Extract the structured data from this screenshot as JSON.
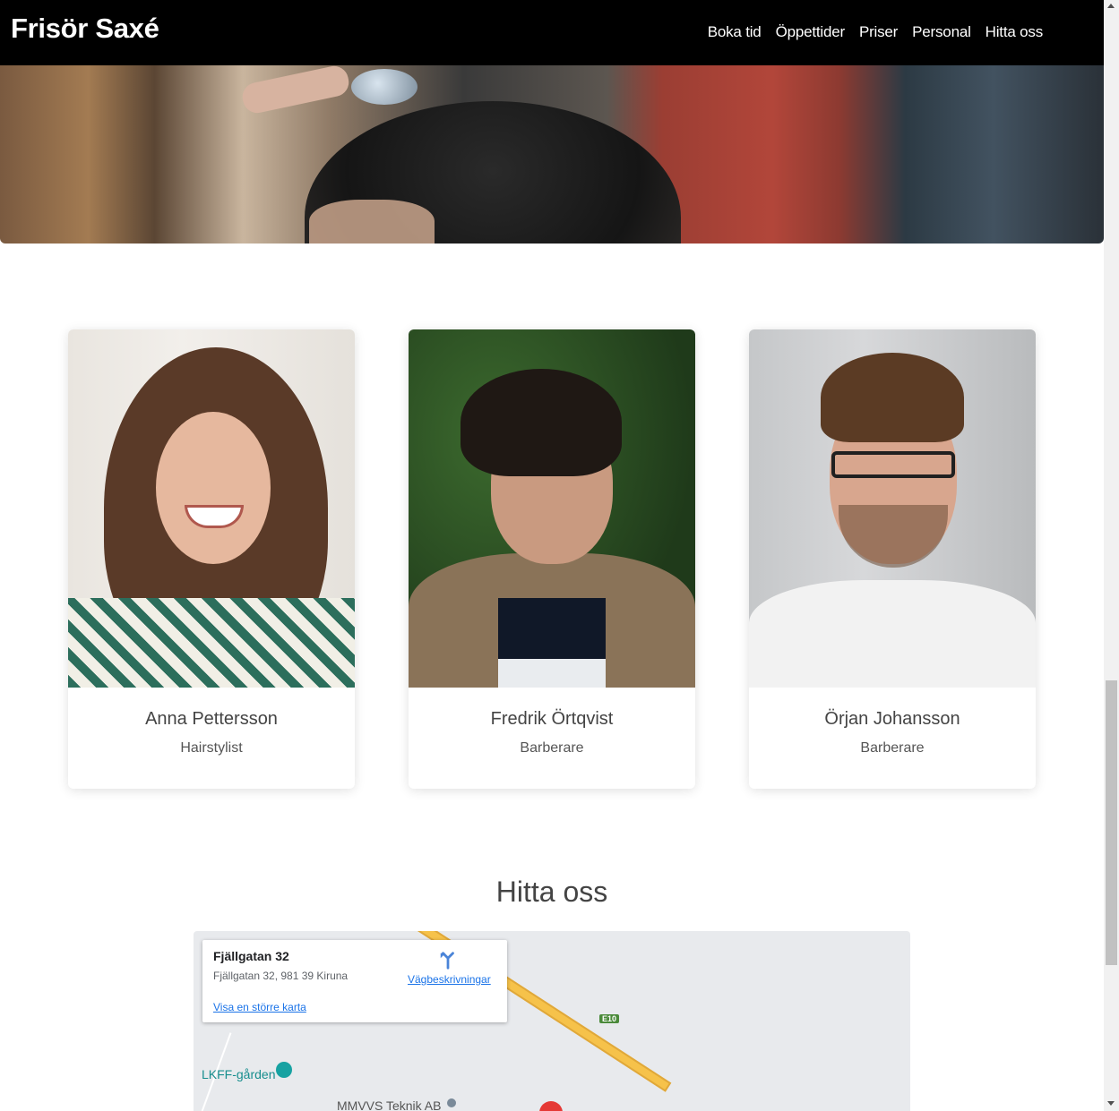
{
  "header": {
    "brand": "Frisör Saxé",
    "nav": [
      "Boka tid",
      "Öppettider",
      "Priser",
      "Personal",
      "Hitta oss"
    ]
  },
  "staff": [
    {
      "name": "Anna Pettersson",
      "role": "Hairstylist"
    },
    {
      "name": "Fredrik Örtqvist",
      "role": "Barberare"
    },
    {
      "name": "Örjan Johansson",
      "role": "Barberare"
    }
  ],
  "find_us": {
    "title": "Hitta oss",
    "map": {
      "place_title": "Fjällgatan 32",
      "address": "Fjällgatan 32, 981 39 Kiruna",
      "directions": "Vägbeskrivningar",
      "larger_map": "Visa en större karta",
      "road_label": "E10",
      "poi_1": "LKFF-gården",
      "poi_2": "MMVVS Teknik AB"
    }
  },
  "colors": {
    "nav_bg": "#000000",
    "link_blue": "#1a73e8",
    "text": "#444444"
  }
}
